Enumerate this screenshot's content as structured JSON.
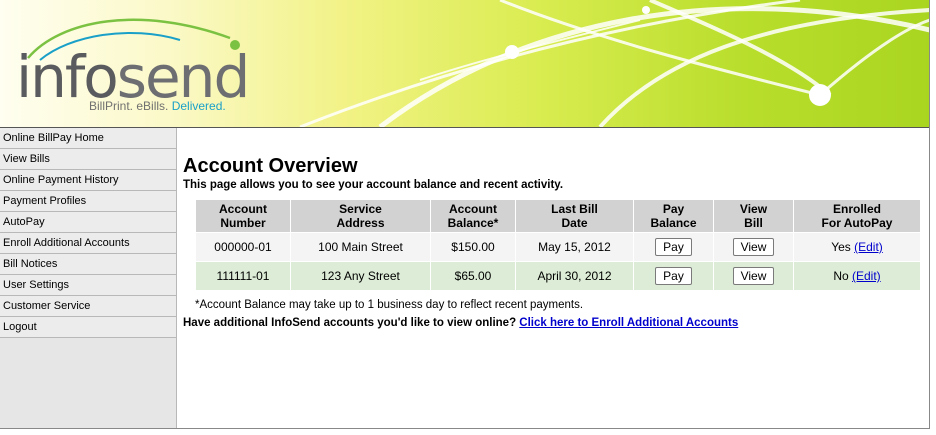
{
  "brand": {
    "logo_info": "info",
    "logo_send": "send",
    "tagline_main": "BillPrint. eBills. ",
    "tagline_delivered": "Delivered.",
    "accent_green": "#a9d520",
    "accent_blue": "#1aa0c8"
  },
  "sidebar": {
    "items": [
      {
        "label": "Online BillPay Home"
      },
      {
        "label": "View Bills"
      },
      {
        "label": "Online Payment History"
      },
      {
        "label": "Payment Profiles"
      },
      {
        "label": "AutoPay"
      },
      {
        "label": "Enroll Additional Accounts"
      },
      {
        "label": "Bill Notices"
      },
      {
        "label": "User Settings"
      },
      {
        "label": "Customer Service"
      },
      {
        "label": "Logout"
      }
    ]
  },
  "main": {
    "title": "Account Overview",
    "description": "This page allows you to see your account balance and recent activity.",
    "table": {
      "headers": [
        {
          "line1": "Account",
          "line2": "Number"
        },
        {
          "line1": "Service",
          "line2": "Address"
        },
        {
          "line1": "Account",
          "line2": "Balance*"
        },
        {
          "line1": "Last Bill",
          "line2": "Date"
        },
        {
          "line1": "Pay",
          "line2": "Balance"
        },
        {
          "line1": "View",
          "line2": "Bill"
        },
        {
          "line1": "Enrolled",
          "line2": "For AutoPay"
        }
      ],
      "rows": [
        {
          "account_number": "000000-01",
          "service_address": "100 Main Street",
          "balance": "$150.00",
          "last_bill_date": "May 15, 2012",
          "pay_label": "Pay",
          "view_label": "View",
          "enrolled": "Yes",
          "edit_label": "(Edit)"
        },
        {
          "account_number": "111111-01",
          "service_address": "123 Any Street",
          "balance": "$65.00",
          "last_bill_date": "April 30, 2012",
          "pay_label": "Pay",
          "view_label": "View",
          "enrolled": "No",
          "edit_label": "(Edit)"
        }
      ]
    },
    "footnote": "*Account Balance may take up to 1 business day to reflect recent payments.",
    "enroll_prompt": "Have additional InfoSend accounts you'd like to view online? ",
    "enroll_link": "Click here to Enroll Additional Accounts"
  }
}
